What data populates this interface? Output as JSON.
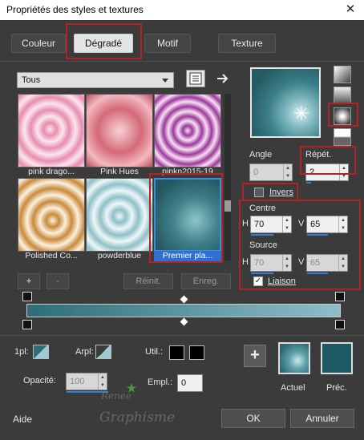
{
  "window": {
    "title": "Propriétés des styles et textures",
    "close": "✕"
  },
  "tabs": [
    {
      "label": "Couleur"
    },
    {
      "label": "Dégradé"
    },
    {
      "label": "Motif"
    },
    {
      "label": "Texture"
    }
  ],
  "category": {
    "value": "Tous"
  },
  "presets": [
    {
      "label": "pink drago..."
    },
    {
      "label": "Pink Hues"
    },
    {
      "label": "pinkn2015-19"
    },
    {
      "label": "Polished Co..."
    },
    {
      "label": "powderblue"
    },
    {
      "label": "Premier pla..."
    }
  ],
  "list_buttons": {
    "add": "+",
    "remove": "-",
    "reset": "Réinit.",
    "save": "Enreg."
  },
  "angle": {
    "label": "Angle",
    "value": "0"
  },
  "repeat": {
    "label": "Répét.",
    "value": "2"
  },
  "invert": {
    "label": "Invers",
    "checked": false
  },
  "center": {
    "label": "Centre",
    "h_label": "H",
    "h_value": "70",
    "v_label": "V",
    "v_value": "65"
  },
  "source": {
    "label": "Source",
    "h_label": "H",
    "h_value": "70",
    "v_label": "V",
    "v_value": "65"
  },
  "link": {
    "label": "Liaison",
    "checked": true
  },
  "bottom": {
    "ipl_label": "1pl:",
    "arpl_label": "Arpl:",
    "util_label": "Util.:",
    "opacity_label": "Opacité:",
    "opacity_value": "100",
    "empl_label": "Empl.:",
    "empl_value": "0",
    "actual_label": "Actuel",
    "prev_label": "Préc.",
    "add_symbol": "+"
  },
  "footer": {
    "help": "Aide",
    "ok": "OK",
    "cancel": "Annuler"
  },
  "watermark": {
    "line1": "Renee",
    "line2": "Graphisme"
  },
  "colors": {
    "gradient_start": "#2e6d77",
    "gradient_end": "#8fbec7",
    "previous": "#1e5a66",
    "highlight": "#b22424",
    "accent": "#2f7ed8"
  }
}
